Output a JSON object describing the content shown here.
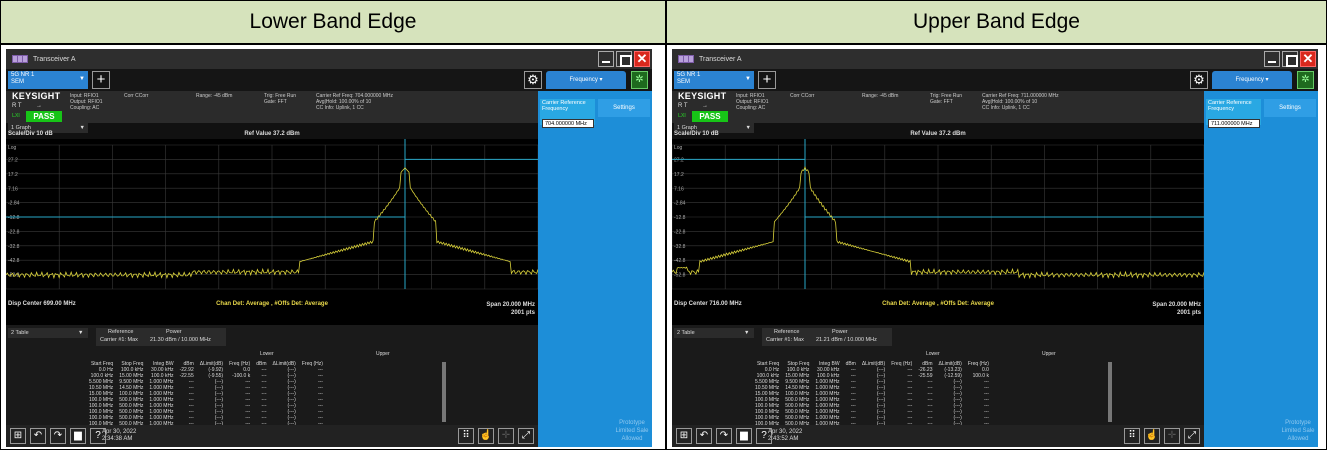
{
  "panels": [
    {
      "header": "Lower Band Edge",
      "window_title": "Transceiver A",
      "mode": {
        "line1": "5G NR 1",
        "line2": "SEM"
      },
      "brand": "KEYSIGHT",
      "rt": "R   T",
      "sweep": "→",
      "lxi": "LXI",
      "status": "PASS",
      "input": "Input: RFIO1",
      "output": "Output: RFIO1",
      "coupling": "Coupling: AC",
      "corr": "Corr CCorr",
      "range": "Range: -45 dBm",
      "trig": "Trig: Free Run",
      "gate": "Gate: FFT",
      "carrier_ref": "Carrier Ref Freq: 704.000000 MHz",
      "avg_hold": "Avg|Hold: 100.00% of 10",
      "cc_info": "CC Info: Uplink, 1 CC",
      "freq_tab": "Frequency",
      "crf_label_1": "Carrier Reference",
      "crf_label_2": "Frequency",
      "crf_value": "704.000000 MHz",
      "settings": "Settings",
      "proto": "Prototype Limited Sale Allowed",
      "graph_sel": "1 Graph",
      "scale": "Scale/Div 10 dB",
      "scale_type": "Log",
      "ref_value": "Ref Value 37.2 dBm",
      "y_ticks": [
        "27.2",
        "17.2",
        "7.16",
        "-2.84",
        "-12.8",
        "-22.8",
        "-32.8",
        "-42.8",
        "-52.8"
      ],
      "disp_center": "Disp Center 699.00 MHz",
      "detector": "Chan Det: Average , #Offs Det: Average",
      "span": "Span 20.000 MHz",
      "points": "2001 pts",
      "table_sel": "2 Table",
      "ref_hdr": "Reference",
      "power_hdr": "Power",
      "carrier_row": "Carrier #1: Max",
      "carrier_val": "21.30 dBm / 10.000 MHz",
      "lower_hdr": "Lower",
      "upper_hdr": "Upper",
      "cols": [
        "Start Freq",
        "Stop Freq",
        "Integ BW",
        "dBm",
        "ΔLimit(dB)",
        "Freq (Hz)",
        "dBm",
        "ΔLimit(dB)",
        "Freq (Hz)"
      ],
      "rows": [
        [
          "0.0 Hz",
          "100.0 kHz",
          "30.00 kHz",
          "-22.92",
          "(-9.92)",
          "0.0",
          "---",
          "(---)",
          "---"
        ],
        [
          "100.0 kHz",
          "15.00 MHz",
          "100.0 kHz",
          "-22.55",
          "(-9.55)",
          "-100.0 k",
          "---",
          "(---)",
          "---"
        ],
        [
          "5.500 MHz",
          "9.500 MHz",
          "1.000 MHz",
          "---",
          "(---)",
          "---",
          "---",
          "(---)",
          "---"
        ],
        [
          "10.50 MHz",
          "14.50 MHz",
          "1.000 MHz",
          "---",
          "(---)",
          "---",
          "---",
          "(---)",
          "---"
        ],
        [
          "15.00 MHz",
          "100.0 MHz",
          "1.000 MHz",
          "---",
          "(---)",
          "---",
          "---",
          "(---)",
          "---"
        ],
        [
          "100.0 MHz",
          "500.0 MHz",
          "1.000 MHz",
          "---",
          "(---)",
          "---",
          "---",
          "(---)",
          "---"
        ],
        [
          "100.0 MHz",
          "500.0 MHz",
          "1.000 MHz",
          "---",
          "(---)",
          "---",
          "---",
          "(---)",
          "---"
        ],
        [
          "100.0 MHz",
          "500.0 MHz",
          "1.000 MHz",
          "---",
          "(---)",
          "---",
          "---",
          "(---)",
          "---"
        ],
        [
          "100.0 MHz",
          "500.0 MHz",
          "1.000 MHz",
          "---",
          "(---)",
          "---",
          "---",
          "(---)",
          "---"
        ],
        [
          "100.0 MHz",
          "500.0 MHz",
          "1.000 MHz",
          "---",
          "(---)",
          "---",
          "---",
          "(---)",
          "---"
        ]
      ],
      "date": "Apr 30, 2022",
      "time": "2:34:38 AM",
      "icons": [
        "windows-icon",
        "undo-icon",
        "redo-icon",
        "folder-icon",
        "help-icon"
      ],
      "trace": {
        "center_mhz": 704.0,
        "noise_dbm": -51,
        "peak_dbm": 21.3,
        "spur_at_mhz": null
      },
      "limit_line": {
        "left_dbm": -12.8,
        "right_dbm": 27.2
      }
    },
    {
      "header": "Upper Band Edge",
      "window_title": "Transceiver A",
      "mode": {
        "line1": "5G NR 1",
        "line2": "SEM"
      },
      "brand": "KEYSIGHT",
      "rt": "R   T",
      "sweep": "→",
      "lxi": "LXI",
      "status": "PASS",
      "input": "Input: RFIO1",
      "output": "Output: RFIO1",
      "coupling": "Coupling: AC",
      "corr": "Corr CCorr",
      "range": "Range: -45 dBm",
      "trig": "Trig: Free Run",
      "gate": "Gate: FFT",
      "carrier_ref": "Carrier Ref Freq: 711.000000 MHz",
      "avg_hold": "Avg|Hold: 100.00% of 10",
      "cc_info": "CC Info: Uplink, 1 CC",
      "freq_tab": "Frequency",
      "crf_label_1": "Carrier Reference",
      "crf_label_2": "Frequency",
      "crf_value": "711.000000 MHz",
      "settings": "Settings",
      "proto": "Prototype Limited Sale Allowed",
      "graph_sel": "1 Graph",
      "scale": "Scale/Div 10 dB",
      "scale_type": "Log",
      "ref_value": "Ref Value 37.2 dBm",
      "y_ticks": [
        "27.2",
        "17.2",
        "7.16",
        "-2.84",
        "-12.8",
        "-22.8",
        "-32.8",
        "-42.8",
        "-52.8"
      ],
      "disp_center": "Disp Center 716.00 MHz",
      "detector": "Chan Det: Average , #Offs Det: Average",
      "span": "Span 20.000 MHz",
      "points": "2001 pts",
      "table_sel": "2 Table",
      "ref_hdr": "Reference",
      "power_hdr": "Power",
      "carrier_row": "Carrier #1: Max",
      "carrier_val": "21.21 dBm / 10.000 MHz",
      "lower_hdr": "Lower",
      "upper_hdr": "Upper",
      "cols": [
        "Start Freq",
        "Stop Freq",
        "Integ BW",
        "dBm",
        "ΔLimit(dB)",
        "Freq (Hz)",
        "dBm",
        "ΔLimit(dB)",
        "Freq (Hz)"
      ],
      "rows": [
        [
          "0.0 Hz",
          "100.0 kHz",
          "30.00 kHz",
          "---",
          "(---)",
          "---",
          "-26.23",
          "(-13.23)",
          "0.0"
        ],
        [
          "100.0 kHz",
          "15.00 MHz",
          "100.0 kHz",
          "---",
          "(---)",
          "---",
          "-25.59",
          "(-12.59)",
          "100.0 k"
        ],
        [
          "5.500 MHz",
          "9.500 MHz",
          "1.000 MHz",
          "---",
          "(---)",
          "---",
          "---",
          "(---)",
          "---"
        ],
        [
          "10.50 MHz",
          "14.50 MHz",
          "1.000 MHz",
          "---",
          "(---)",
          "---",
          "---",
          "(---)",
          "---"
        ],
        [
          "15.00 MHz",
          "100.0 MHz",
          "1.000 MHz",
          "---",
          "(---)",
          "---",
          "---",
          "(---)",
          "---"
        ],
        [
          "100.0 MHz",
          "500.0 MHz",
          "1.000 MHz",
          "---",
          "(---)",
          "---",
          "---",
          "(---)",
          "---"
        ],
        [
          "100.0 MHz",
          "500.0 MHz",
          "1.000 MHz",
          "---",
          "(---)",
          "---",
          "---",
          "(---)",
          "---"
        ],
        [
          "100.0 MHz",
          "500.0 MHz",
          "1.000 MHz",
          "---",
          "(---)",
          "---",
          "---",
          "(---)",
          "---"
        ],
        [
          "100.0 MHz",
          "500.0 MHz",
          "1.000 MHz",
          "---",
          "(---)",
          "---",
          "---",
          "(---)",
          "---"
        ],
        [
          "100.0 MHz",
          "500.0 MHz",
          "1.000 MHz",
          "---",
          "(---)",
          "---",
          "---",
          "(---)",
          "---"
        ]
      ],
      "date": "Apr 30, 2022",
      "time": "2:43:52 AM",
      "icons": [
        "windows-icon",
        "undo-icon",
        "redo-icon",
        "folder-icon",
        "help-icon"
      ],
      "trace": {
        "center_mhz": 711.0,
        "noise_dbm": -51,
        "peak_dbm": 21.2,
        "spur_at_mhz": 706.4
      },
      "limit_line": {
        "left_dbm": 27.2,
        "right_dbm": -12.8
      }
    }
  ],
  "colors": {
    "header_bg": "#d6e3bc",
    "trace": "#d9d13a",
    "limit": "#29a8c8",
    "accent": "#1d8ed8",
    "pass": "#17c417"
  }
}
